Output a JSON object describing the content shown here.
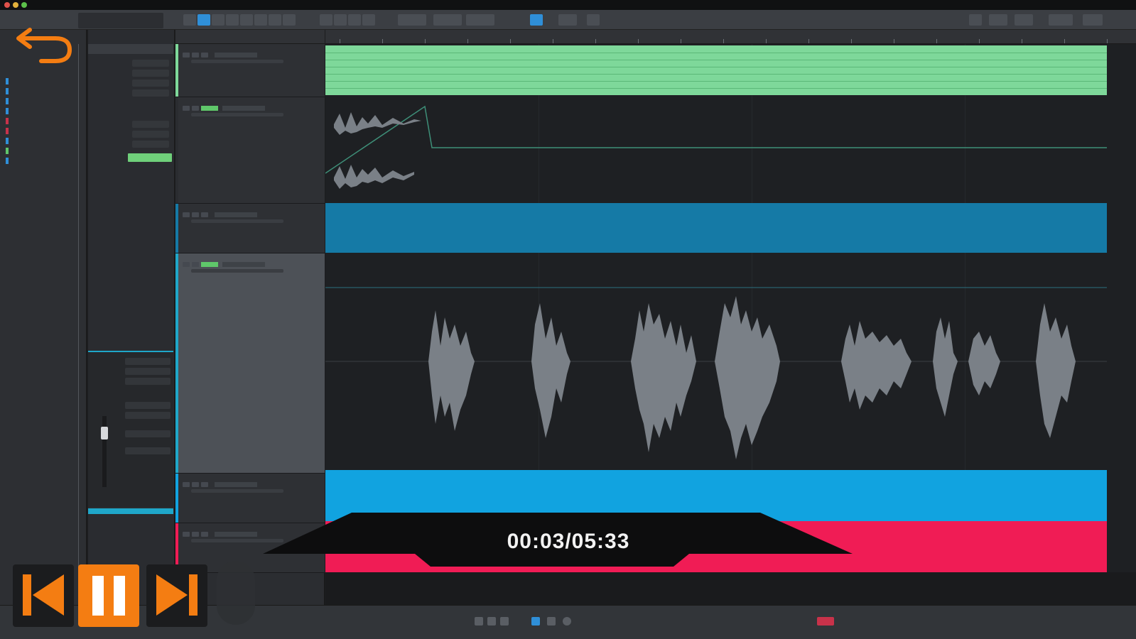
{
  "player": {
    "time_display": "00:03/05:33",
    "back_icon": "undo-arrow-icon",
    "prev_icon": "skip-previous-icon",
    "pause_icon": "pause-icon",
    "next_icon": "skip-next-icon",
    "accent_color": "#f47d12"
  },
  "daw": {
    "tracks": [
      {
        "color": "#7ed89a",
        "clip_color": "#7ed89a"
      },
      {
        "color": "#2a2c30",
        "clip_color": "#1e2023"
      },
      {
        "color": "#157aa6",
        "clip_color": "#157aa6"
      },
      {
        "color": "#1fa7c9",
        "clip_color": "#1e2023",
        "selected": true
      },
      {
        "color": "#11a3e0",
        "clip_color": "#11a3e0"
      },
      {
        "color": "#f01c55",
        "clip_color": "#f01c55"
      }
    ],
    "browser_swatches": [
      "#2f8fd8",
      "#2f8fd8",
      "#2f8fd8",
      "#2f8fd8",
      "#c8324a",
      "#c8324a",
      "#2f8fd8",
      "#5fc76a",
      "#2f8fd8"
    ],
    "accent_green": "#6fd07a",
    "accent_cyan": "#1fa7c9"
  }
}
